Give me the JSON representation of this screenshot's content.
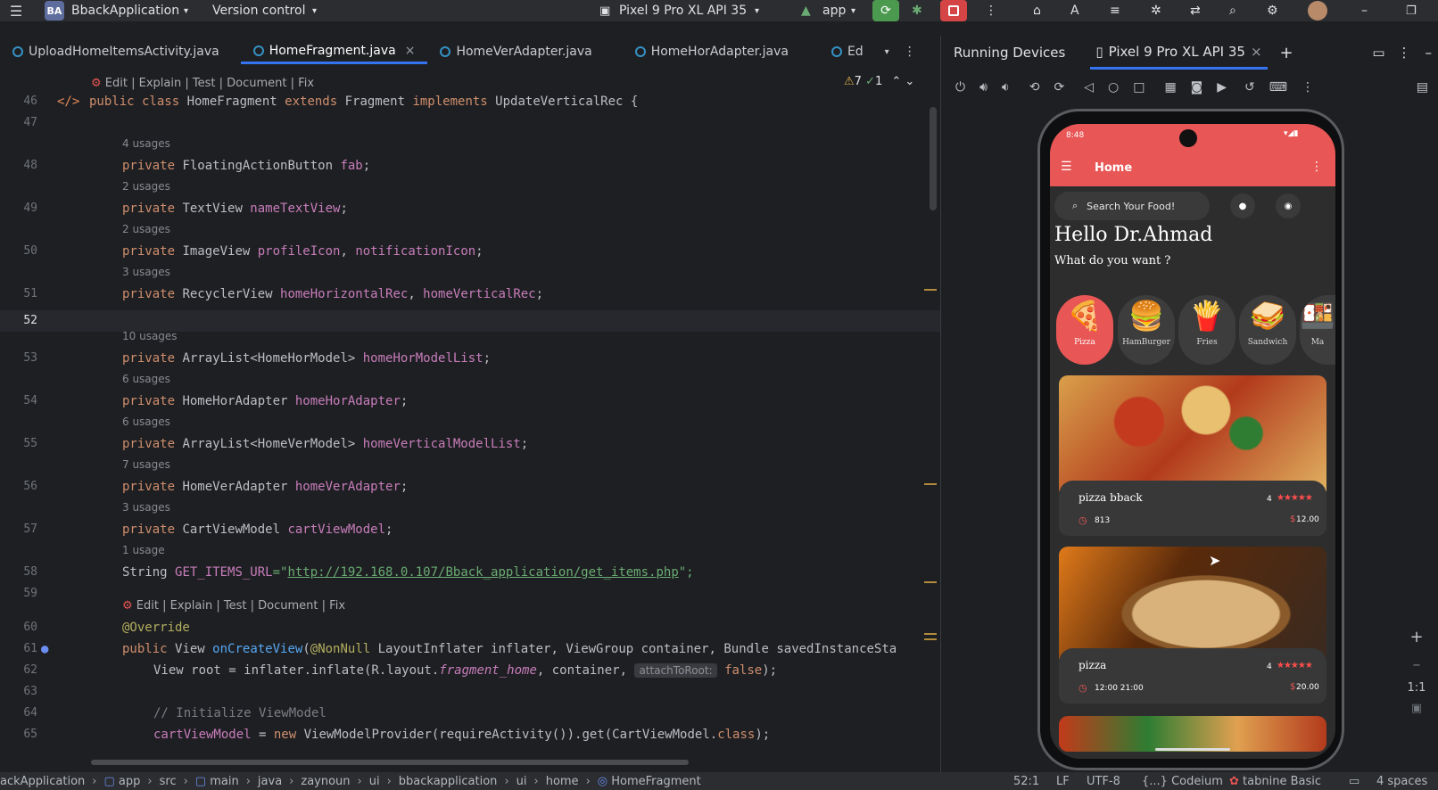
{
  "topbar": {
    "project_badge": "BA",
    "project_name": "BbackApplication",
    "vcs": "Version control",
    "device": "Pixel 9 Pro XL API 35",
    "run_config": "app"
  },
  "tabs": [
    "UploadHomeItemsActivity.java",
    "HomeFragment.java",
    "HomeVerAdapter.java",
    "HomeHorAdapter.java",
    "Ed"
  ],
  "ai_actions": [
    "Edit",
    "Explain",
    "Test",
    "Document",
    "Fix"
  ],
  "inspections": {
    "warnings": "7",
    "weak": "1"
  },
  "code": {
    "l46": {
      "n": "46",
      "a": "public class ",
      "b": "HomeFragment ",
      "c": "extends ",
      "d": "Fragment ",
      "e": "implements ",
      "f": "UpdateVerticalRec {"
    },
    "l47": {
      "n": "47"
    },
    "u48": "4 usages",
    "l48": {
      "n": "48",
      "a": "private ",
      "b": "FloatingActionButton ",
      "c": "fab",
      ";": ";"
    },
    "u49": "2 usages",
    "l49": {
      "n": "49",
      "a": "private ",
      "b": "TextView ",
      "c": "nameTextView",
      ";": ";"
    },
    "u50": "2 usages",
    "l50": {
      "n": "50",
      "a": "private ",
      "b": "ImageView ",
      "c": "profileIcon",
      ",": ", ",
      "d": "notificationIcon",
      ";": ";"
    },
    "u51": "3 usages",
    "l51": {
      "n": "51",
      "a": "private ",
      "b": "RecyclerView ",
      "c": "homeHorizontalRec",
      ",": ", ",
      "d": "homeVerticalRec",
      ";": ";"
    },
    "l52": {
      "n": "52"
    },
    "u53": "10 usages",
    "l53": {
      "n": "53",
      "a": "private ",
      "b": "ArrayList<HomeHorModel> ",
      "c": "homeHorModelList",
      ";": ";"
    },
    "u54": "6 usages",
    "l54": {
      "n": "54",
      "a": "private ",
      "b": "HomeHorAdapter ",
      "c": "homeHorAdapter",
      ";": ";"
    },
    "u55": "6 usages",
    "l55": {
      "n": "55",
      "a": "private ",
      "b": "ArrayList<HomeVerModel> ",
      "c": "homeVerticalModelList",
      ";": ";"
    },
    "u56": "7 usages",
    "l56": {
      "n": "56",
      "a": "private ",
      "b": "HomeVerAdapter ",
      "c": "homeVerAdapter",
      ";": ";"
    },
    "u57": "3 usages",
    "l57": {
      "n": "57",
      "a": "private ",
      "b": "CartViewModel ",
      "c": "cartViewModel",
      ";": ";"
    },
    "u58": "1 usage",
    "l58": {
      "n": "58",
      "a": "String ",
      "c": "GET_ITEMS_URL",
      "eq": "=\"",
      "s": "http://192.168.0.107/Bback_application/get_items.php",
      "end": "\";"
    },
    "l59": {
      "n": "59"
    },
    "l60": {
      "n": "60",
      "a": "@Override"
    },
    "l61": {
      "n": "61",
      "a": "public ",
      "b": "View ",
      "c": "onCreateView",
      "d": "(",
      "e": "@NonNull ",
      "f": "LayoutInflater inflater, ViewGroup container, Bundle savedInstanceSta"
    },
    "l62": {
      "n": "62",
      "a": "View root = inflater.inflate(R.layout.",
      "b": "fragment_home",
      ",": ", container, ",
      "hint": "attachToRoot:",
      "c": " false",
      ";": ");"
    },
    "l63": {
      "n": "63"
    },
    "l64": {
      "n": "64",
      "a": "// Initialize ViewModel"
    },
    "l65": {
      "n": "65",
      "a": "cartViewModel ",
      "b": "= ",
      "c": "new ",
      "d": "ViewModelProvider(requireActivity()).get(CartViewModel.",
      "e": "class",
      ";": ");"
    }
  },
  "running": {
    "title": "Running Devices",
    "device_tab": "Pixel 9 Pro XL API 35",
    "zoom": "1:1"
  },
  "phone": {
    "time": "8:48",
    "appbar_title": "Home",
    "search_placeholder": "Search Your Food!",
    "greeting": "Hello Dr.Ahmad",
    "subtitle": "What do you want ?",
    "categories": [
      "Pizza",
      "HamBurger",
      "Fries",
      "Sandwich",
      "Ma"
    ],
    "items": [
      {
        "name": "pizza bback",
        "rating": "4",
        "time": "813",
        "price": "12.00"
      },
      {
        "name": "pizza",
        "rating": "4",
        "time": "12:00 21:00",
        "price": "20.00"
      }
    ],
    "currency": "$"
  },
  "status": {
    "crumbs": [
      "ackApplication",
      "app",
      "src",
      "main",
      "java",
      "zaynoun",
      "ui",
      "bbackapplication",
      "ui",
      "home",
      "HomeFragment"
    ],
    "pos": "52:1",
    "lf": "LF",
    "enc": "UTF-8",
    "ai": "Codeium",
    "tabnine": "tabnine Basic",
    "indent": "4 spaces"
  },
  "colors": {
    "accent": "#e85655",
    "bg": "#1e1f22",
    "keyword": "#cf8e6d",
    "field": "#c77dbb",
    "string": "#6aab73"
  }
}
